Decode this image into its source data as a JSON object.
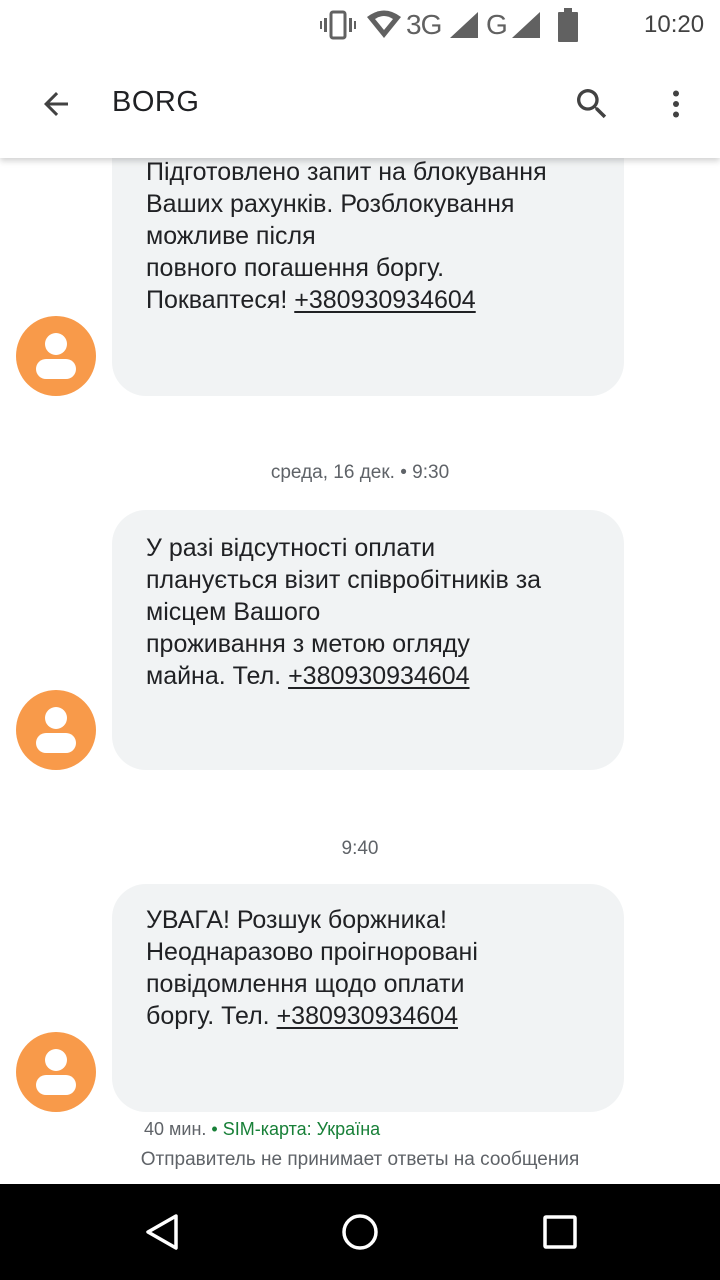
{
  "status_bar": {
    "network_3g": "3G",
    "network_g": "G",
    "time": "10:20",
    "icons": [
      "vibrate-icon",
      "wifi-icon",
      "signal-icon",
      "signal-icon",
      "battery-icon"
    ]
  },
  "app_bar": {
    "title": "BORG",
    "icons": [
      "back-arrow-icon",
      "search-icon",
      "more-vert-icon"
    ]
  },
  "messages": [
    {
      "text": "Підготовлено запит на блокування\nВаших рахунків. Розблокування\nможливе після\nповного погашення боргу.\nПокваптеся! ",
      "phone": "+380930934604"
    },
    {
      "date_separator": "среда, 16 дек. • 9:30",
      "text": "У разі відсутності оплати\nпланується візит співробітників за\nмісцем Вашого\nпроживання з метою огляду\nмайна. Тел. ",
      "phone": "+380930934604"
    },
    {
      "date_separator": "9:40",
      "text": "УВАГА! Розшук боржника!\nНеоднаразово проігноровані\nповідомлення щодо оплати\nборгу. Тел. ",
      "phone": "+380930934604"
    }
  ],
  "footer": {
    "age": "40 мин.",
    "separator": " • ",
    "sim": "SIM-карта: Україна",
    "noreply": "Отправитель не принимает ответы на сообщения"
  },
  "colors": {
    "avatar": "#f89a4a",
    "bubble": "#f1f3f4",
    "sim_text": "#188038"
  },
  "nav_bar": {
    "icons": [
      "nav-back-icon",
      "nav-home-icon",
      "nav-recents-icon"
    ]
  }
}
